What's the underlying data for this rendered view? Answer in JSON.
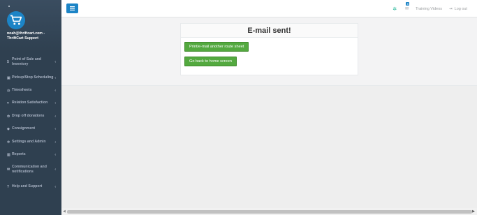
{
  "user": {
    "name_line1": "noah@thriftcart.com -",
    "name_line2": "ThriftCart Support"
  },
  "sidebar": {
    "items": [
      {
        "label": "Point of Sale and Inventory",
        "icon": "dollar-icon",
        "glyph": "$"
      },
      {
        "label": "Pickup/Stop Scheduling",
        "icon": "truck-icon",
        "glyph": "▣"
      },
      {
        "label": "Timesheets",
        "icon": "clock-icon",
        "glyph": "◷"
      },
      {
        "label": "Relation Satisfaction",
        "icon": "heart-icon",
        "glyph": "♥"
      },
      {
        "label": "Drop off donations",
        "icon": "gift-icon",
        "glyph": "✿"
      },
      {
        "label": "Consignment",
        "icon": "tag-icon",
        "glyph": "◆"
      },
      {
        "label": "Settings and Admin",
        "icon": "gear-icon",
        "glyph": "✲"
      },
      {
        "label": "Reports",
        "icon": "bar-chart-icon",
        "glyph": "▥"
      },
      {
        "label": "Communication and notifications",
        "icon": "envelope-icon",
        "glyph": "✉"
      },
      {
        "label": "Help and Support",
        "icon": "question-icon",
        "glyph": "?"
      }
    ],
    "chevron": "‹"
  },
  "topbar": {
    "menu_icon": "hamburger-icon",
    "gear_icon": "gear-icon",
    "mail_icon": "envelope-icon",
    "mail_badge": "8",
    "training_label": "Training Videos",
    "logout_label": "Log out"
  },
  "main": {
    "title": "E-mail sent!",
    "button1_label": "Print/e-mail another route sheet",
    "button2_label": "Go back to home screen"
  },
  "colors": {
    "sidebar_bg": "#2f4050",
    "primary": "#1c84c6",
    "success": "#53a93f"
  }
}
